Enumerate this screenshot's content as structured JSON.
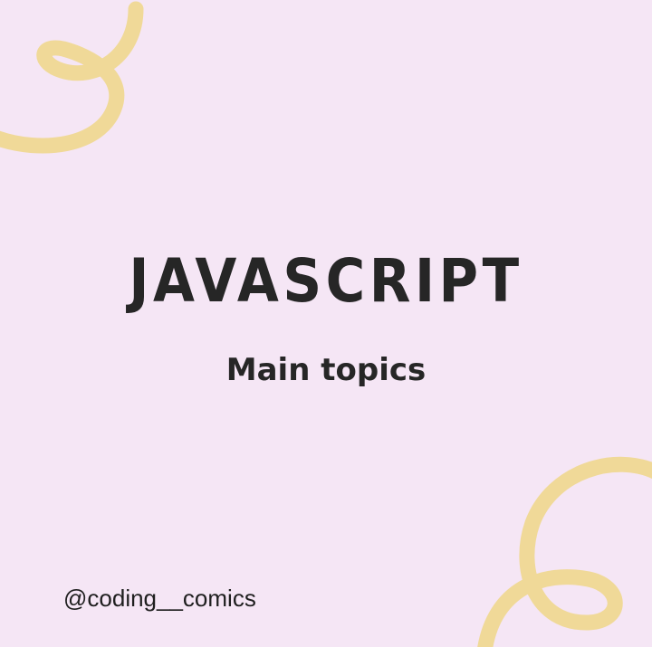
{
  "post": {
    "title": "JAVASCRIPT",
    "subtitle": "Main topics",
    "handle": "@coding__comics"
  },
  "decorations": {
    "top_left": "squiggle-swirl",
    "bottom_right": "squiggle-swirl"
  },
  "colors": {
    "background": "#f5e6f5",
    "squiggle": "#f0d998",
    "text": "#262626"
  }
}
